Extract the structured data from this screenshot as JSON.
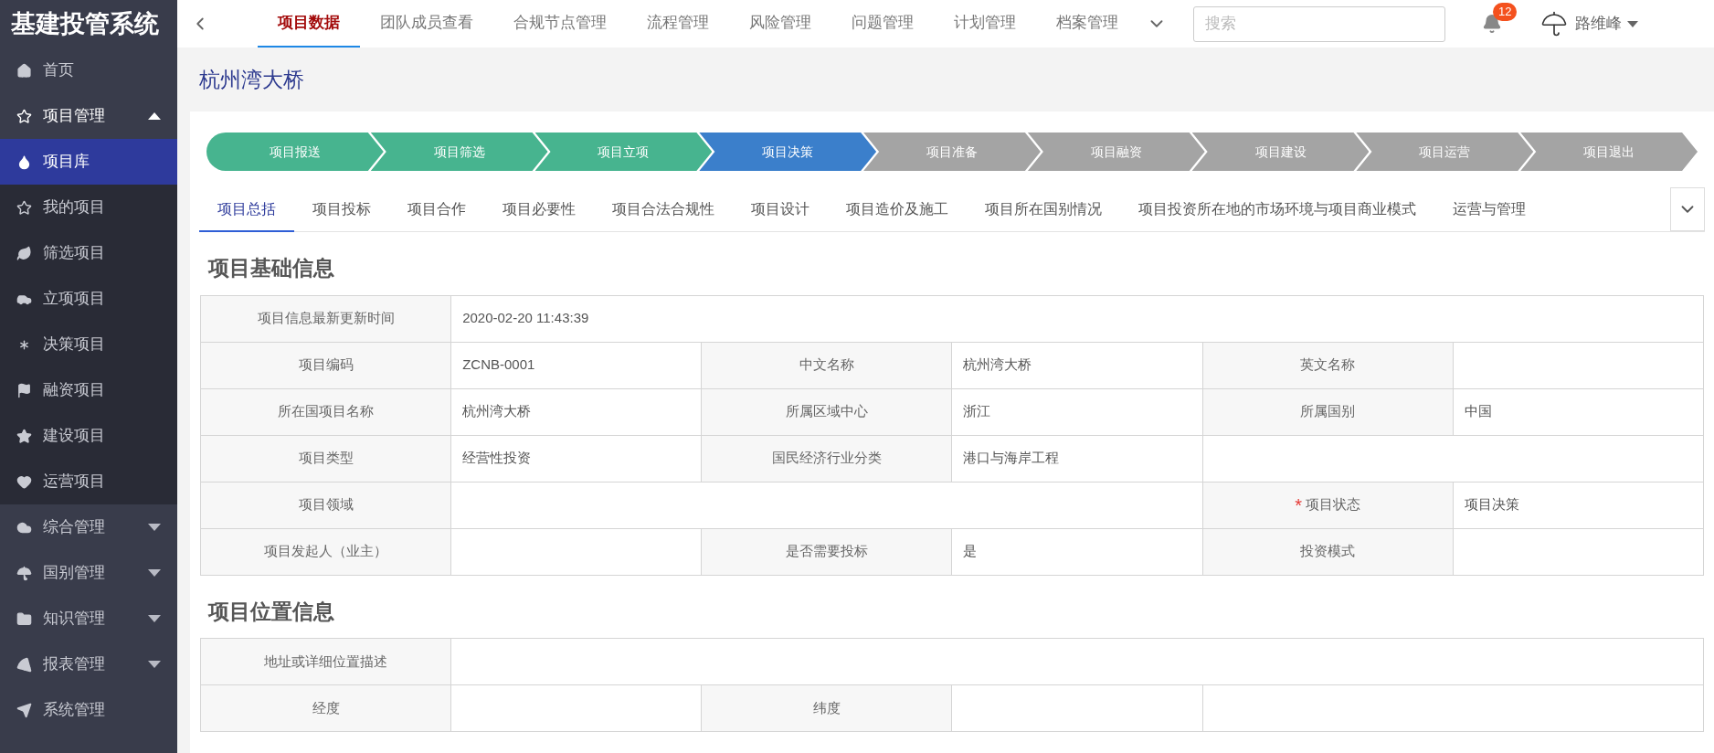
{
  "app": {
    "title": "基建投管系统"
  },
  "sidebar": {
    "items": [
      {
        "label": "首页"
      },
      {
        "label": "项目管理",
        "expanded": true,
        "children": [
          {
            "label": "项目库",
            "selected": true
          },
          {
            "label": "我的项目",
            "selected": false
          },
          {
            "label": "筛选项目",
            "selected": false
          },
          {
            "label": "立项项目",
            "selected": false
          },
          {
            "label": "决策项目",
            "selected": false
          },
          {
            "label": "融资项目",
            "selected": false
          },
          {
            "label": "建设项目",
            "selected": false
          },
          {
            "label": "运营项目",
            "selected": false
          }
        ]
      },
      {
        "label": "综合管理",
        "expanded": false
      },
      {
        "label": "国别管理",
        "expanded": false
      },
      {
        "label": "知识管理",
        "expanded": false
      },
      {
        "label": "报表管理",
        "expanded": false
      },
      {
        "label": "系统管理"
      }
    ]
  },
  "top_nav": {
    "tabs": [
      {
        "label": "项目数据",
        "selected": true
      },
      {
        "label": "团队成员查看",
        "selected": false
      },
      {
        "label": "合规节点管理",
        "selected": false
      },
      {
        "label": "流程管理",
        "selected": false
      },
      {
        "label": "风险管理",
        "selected": false
      },
      {
        "label": "问题管理",
        "selected": false
      },
      {
        "label": "计划管理",
        "selected": false
      },
      {
        "label": "档案管理",
        "selected": false
      }
    ],
    "search": {
      "placeholder": "搜索"
    },
    "notifications": {
      "count": "12"
    },
    "user": {
      "name": "路维峰"
    }
  },
  "page": {
    "title": "杭州湾大桥"
  },
  "steps": [
    {
      "label": "项目报送",
      "selected": false
    },
    {
      "label": "项目筛选",
      "selected": false
    },
    {
      "label": "项目立项",
      "selected": false
    },
    {
      "label": "项目决策",
      "selected": true
    },
    {
      "label": "项目准备",
      "selected": false
    },
    {
      "label": "项目融资",
      "selected": false
    },
    {
      "label": "项目建设",
      "selected": false
    },
    {
      "label": "项目运营",
      "selected": false
    },
    {
      "label": "项目退出",
      "selected": false
    }
  ],
  "tabs": [
    {
      "label": "项目总括",
      "selected": true
    },
    {
      "label": "项目投标",
      "selected": false
    },
    {
      "label": "项目合作",
      "selected": false
    },
    {
      "label": "项目必要性",
      "selected": false
    },
    {
      "label": "项目合法合规性",
      "selected": false
    },
    {
      "label": "项目设计",
      "selected": false
    },
    {
      "label": "项目造价及施工",
      "selected": false
    },
    {
      "label": "项目所在国别情况",
      "selected": false
    },
    {
      "label": "项目投资所在地的市场环境与项目商业模式",
      "selected": false
    },
    {
      "label": "运营与管理",
      "selected": false
    }
  ],
  "sections": [
    {
      "title": "项目基础信息",
      "rows": [
        [
          {
            "kind": "label",
            "text": "项目信息最新更新时间"
          },
          {
            "kind": "value",
            "text": "2020-02-20 11:43:39"
          },
          {
            "kind": "merged"
          },
          {
            "kind": "merged"
          },
          {
            "kind": "merged"
          },
          {
            "kind": "merged"
          }
        ],
        [
          {
            "kind": "label",
            "text": "项目编码"
          },
          {
            "kind": "value",
            "text": "ZCNB-0001"
          },
          {
            "kind": "label",
            "text": "中文名称"
          },
          {
            "kind": "value",
            "text": "杭州湾大桥"
          },
          {
            "kind": "label",
            "text": "英文名称"
          },
          {
            "kind": "value"
          }
        ],
        [
          {
            "kind": "label",
            "text": "所在国项目名称"
          },
          {
            "kind": "value",
            "text": "杭州湾大桥"
          },
          {
            "kind": "label",
            "text": "所属区域中心"
          },
          {
            "kind": "value",
            "text": "浙江"
          },
          {
            "kind": "label",
            "text": "所属国别"
          },
          {
            "kind": "value",
            "text": "中国"
          }
        ],
        [
          {
            "kind": "label",
            "text": "项目类型"
          },
          {
            "kind": "value",
            "text": "经营性投资"
          },
          {
            "kind": "label",
            "text": "国民经济行业分类"
          },
          {
            "kind": "value",
            "text": "港口与海岸工程"
          },
          {
            "kind": "value"
          },
          {
            "kind": "merged"
          }
        ],
        [
          {
            "kind": "label",
            "text": "项目领域"
          },
          {
            "kind": "value"
          },
          {
            "kind": "merged"
          },
          {
            "kind": "merged"
          },
          {
            "kind": "label",
            "text": "项目状态",
            "required_mark": "*"
          },
          {
            "kind": "value",
            "text": "项目决策"
          }
        ],
        [
          {
            "kind": "label",
            "text": "项目发起人（业主）"
          },
          {
            "kind": "value"
          },
          {
            "kind": "label",
            "text": "是否需要投标"
          },
          {
            "kind": "value",
            "text": "是"
          },
          {
            "kind": "label",
            "text": "投资模式"
          },
          {
            "kind": "value"
          }
        ]
      ]
    },
    {
      "title": "项目位置信息",
      "rows": [
        [
          {
            "kind": "label",
            "text": "地址或详细位置描述"
          },
          {
            "kind": "value"
          },
          {
            "kind": "merged"
          },
          {
            "kind": "merged"
          },
          {
            "kind": "merged"
          },
          {
            "kind": "merged"
          }
        ],
        [
          {
            "kind": "label",
            "text": "经度"
          },
          {
            "kind": "value"
          },
          {
            "kind": "label",
            "text": "纬度"
          },
          {
            "kind": "value"
          },
          {
            "kind": "value"
          },
          {
            "kind": "merged"
          }
        ]
      ]
    }
  ]
}
